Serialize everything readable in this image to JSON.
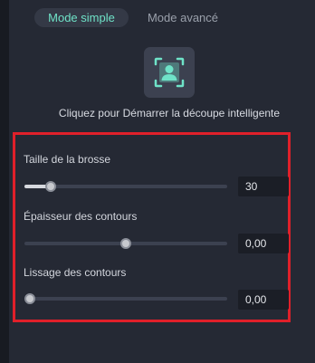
{
  "modes": {
    "simple_label": "Mode simple",
    "advanced_label": "Mode avancé"
  },
  "cutout": {
    "icon": "person-cutout-icon",
    "instruction": "Cliquez pour Démarrer la découpe intelligente"
  },
  "brush_settings": {
    "brush_size": {
      "label": "Taille de la brosse",
      "value": "30",
      "fraction": 0.11
    },
    "contour_thickness": {
      "label": "Épaisseur des contours",
      "value": "0,00",
      "fraction": 0.5
    },
    "contour_smoothing": {
      "label": "Lissage des contours",
      "value": "0,00",
      "fraction": 0.0
    }
  },
  "colors": {
    "accent": "#6fe3c8",
    "highlight_border": "#e0202a",
    "background": "#252934"
  }
}
